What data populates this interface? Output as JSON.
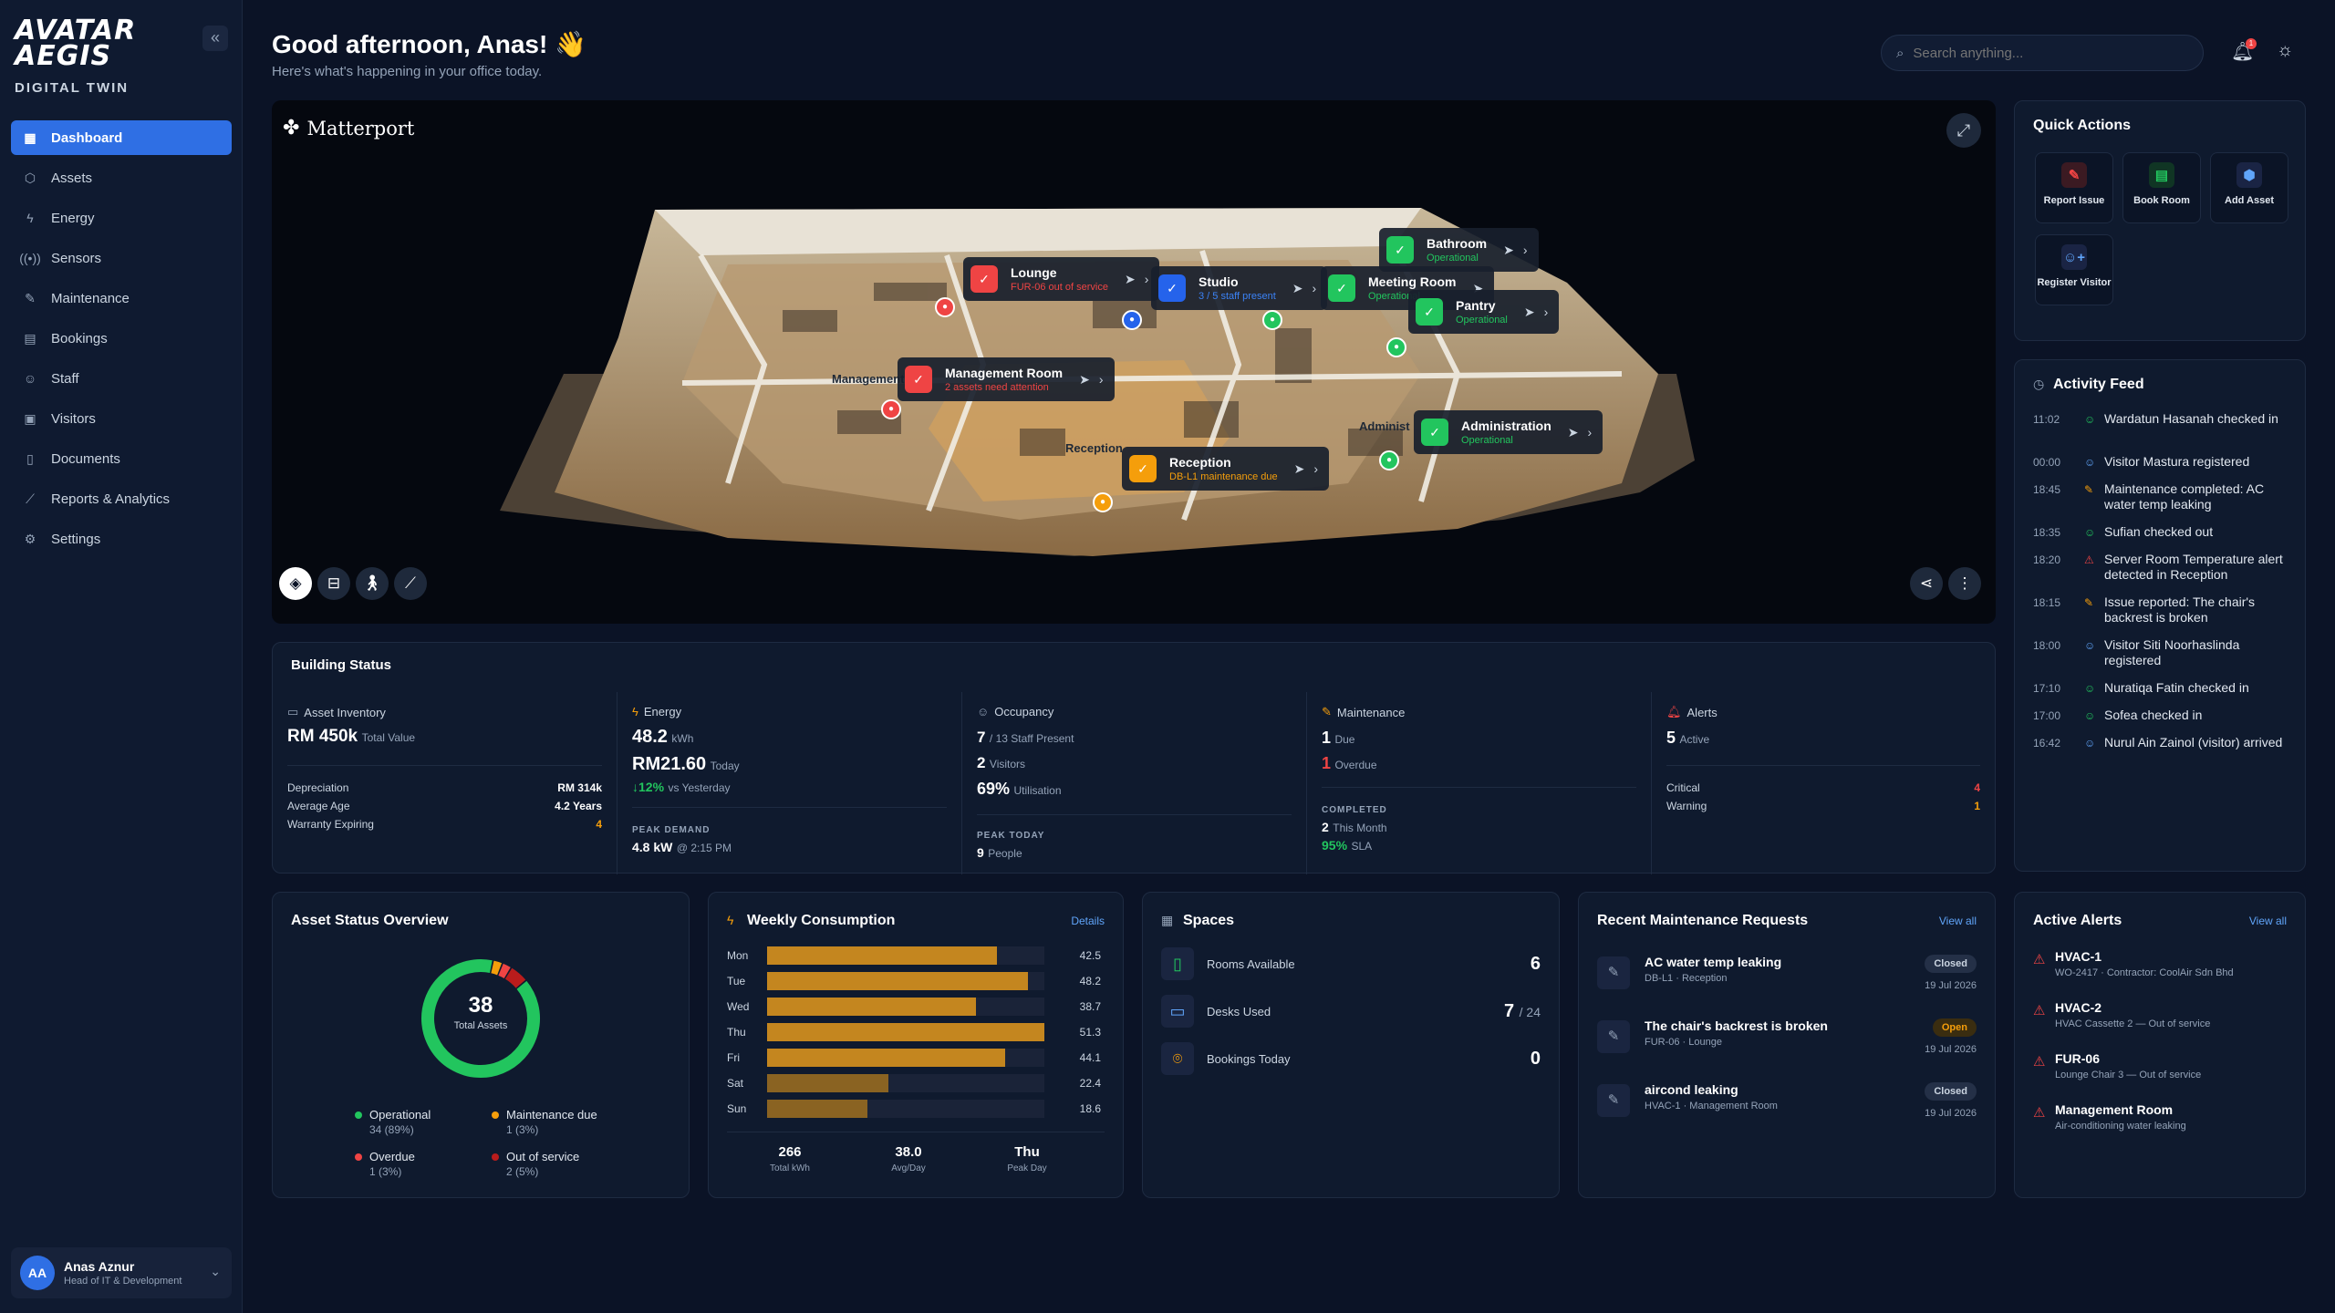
{
  "brand": {
    "logo_line1": "AVATAR",
    "logo_line2": "AEGIS",
    "subtitle": "DIGITAL TWIN"
  },
  "sidebar": {
    "items": [
      {
        "label": "Dashboard",
        "icon": "grid-icon"
      },
      {
        "label": "Assets",
        "icon": "cubes-icon"
      },
      {
        "label": "Energy",
        "icon": "bolt-icon"
      },
      {
        "label": "Sensors",
        "icon": "signal-icon"
      },
      {
        "label": "Maintenance",
        "icon": "wrench-icon"
      },
      {
        "label": "Bookings",
        "icon": "calendar-icon"
      },
      {
        "label": "Staff",
        "icon": "user-icon"
      },
      {
        "label": "Visitors",
        "icon": "id-card-icon"
      },
      {
        "label": "Documents",
        "icon": "document-icon"
      },
      {
        "label": "Reports & Analytics",
        "icon": "chart-icon"
      },
      {
        "label": "Settings",
        "icon": "gear-icon"
      }
    ],
    "user": {
      "initials": "AA",
      "name": "Anas Aznur",
      "role": "Head of IT & Development"
    }
  },
  "header": {
    "greeting": "Good afternoon, Anas! 👋",
    "sub": "Here's what's happening in your office today.",
    "search_placeholder": "Search anything...",
    "notif_count": "1"
  },
  "viewer": {
    "brand": "Matterport",
    "rooms": [
      {
        "name": "Lounge",
        "status": "FUR-06 out of service",
        "state": "red"
      },
      {
        "name": "Studio",
        "status": "3 / 5 staff present",
        "state": "blue"
      },
      {
        "name": "Meeting Room",
        "status": "Operational",
        "state": "green"
      },
      {
        "name": "Bathroom",
        "status": "Operational",
        "state": "green"
      },
      {
        "name": "Pantry",
        "status": "Operational",
        "state": "green"
      },
      {
        "name": "Management Room",
        "status": "2 assets need attention",
        "state": "red"
      },
      {
        "name": "Administration",
        "status": "Operational",
        "state": "green"
      },
      {
        "name": "Reception",
        "status": "DB-L1 maintenance due",
        "state": "orange"
      }
    ],
    "floor_labels": [
      "Management",
      "Reception",
      "Administ"
    ]
  },
  "building_status": {
    "title": "Building Status",
    "asset": {
      "h": "Asset Inventory",
      "value": "RM 450k",
      "unit": "Total Value",
      "rows": [
        [
          "Depreciation",
          "RM 314k"
        ],
        [
          "Average Age",
          "4.2 Years"
        ],
        [
          "Warranty Expiring",
          "4"
        ]
      ]
    },
    "energy": {
      "h": "Energy",
      "kwh": "48.2",
      "kwh_u": "kWh",
      "cost": "RM21.60",
      "cost_u": "Today",
      "delta": "↓12%",
      "delta_u": "vs Yesterday",
      "peak_cap": "PEAK DEMAND",
      "peak": "4.8 kW",
      "peak_u": "@ 2:15 PM"
    },
    "occupancy": {
      "h": "Occupancy",
      "staff": "7",
      "staff_u": "/ 13 Staff Present",
      "visitors": "2",
      "visitors_u": "Visitors",
      "util": "69%",
      "util_u": "Utilisation",
      "peak_cap": "PEAK TODAY",
      "peak": "9",
      "peak_u": "People"
    },
    "maintenance": {
      "h": "Maintenance",
      "due": "1",
      "due_u": "Due",
      "overdue": "1",
      "overdue_u": "Overdue",
      "comp_cap": "COMPLETED",
      "comp": "2",
      "comp_u": "This Month",
      "sla": "95%",
      "sla_u": "SLA"
    },
    "alerts": {
      "h": "Alerts",
      "active": "5",
      "active_u": "Active",
      "rows": [
        [
          "Critical",
          "4"
        ],
        [
          "Warning",
          "1"
        ]
      ]
    }
  },
  "quick_actions": {
    "title": "Quick Actions",
    "items": [
      {
        "label": "Report Issue",
        "icon": "wrench-icon"
      },
      {
        "label": "Book Room",
        "icon": "calendar-icon"
      },
      {
        "label": "Add Asset",
        "icon": "box-icon"
      },
      {
        "label": "Register Visitor",
        "icon": "user-plus-icon"
      }
    ]
  },
  "activity": {
    "title": "Activity Feed",
    "items": [
      {
        "time": "11:02",
        "text": "Wardatun Hasanah checked in",
        "kind": "user"
      },
      {
        "time": "00:00",
        "text": "Visitor Mastura registered",
        "kind": "visitor"
      },
      {
        "time": "18:45",
        "text": "Maintenance completed: AC water temp leaking",
        "kind": "wrench"
      },
      {
        "time": "18:35",
        "text": "Sufian checked out",
        "kind": "user"
      },
      {
        "time": "18:20",
        "text": "Server Room Temperature alert detected in Reception",
        "kind": "alert"
      },
      {
        "time": "18:15",
        "text": "Issue reported: The chair's backrest is broken",
        "kind": "wrench"
      },
      {
        "time": "18:00",
        "text": "Visitor Siti Noorhaslinda registered",
        "kind": "visitor"
      },
      {
        "time": "17:10",
        "text": "Nuratiqa Fatin checked in",
        "kind": "user"
      },
      {
        "time": "17:00",
        "text": "Sofea checked in",
        "kind": "user"
      },
      {
        "time": "16:42",
        "text": "Nurul Ain Zainol (visitor) arrived",
        "kind": "visitor"
      }
    ]
  },
  "asset_overview": {
    "title": "Asset Status Overview",
    "total": "38",
    "total_label": "Total Assets",
    "segments": [
      {
        "name": "Operational",
        "count": 34,
        "label": "34 (89%)",
        "color": "#22c55e"
      },
      {
        "name": "Maintenance due",
        "count": 1,
        "label": "1 (3%)",
        "color": "#f59e0b"
      },
      {
        "name": "Overdue",
        "count": 1,
        "label": "1 (3%)",
        "color": "#ef4444"
      },
      {
        "name": "Out of service",
        "count": 2,
        "label": "2 (5%)",
        "color": "#b91c1c"
      }
    ]
  },
  "weekly": {
    "title": "Weekly Consumption",
    "link": "Details",
    "chart_data": {
      "type": "bar",
      "categories": [
        "Mon",
        "Tue",
        "Wed",
        "Thu",
        "Fri",
        "Sat",
        "Sun"
      ],
      "values": [
        42.5,
        48.2,
        38.7,
        51.3,
        44.1,
        22.4,
        18.6
      ],
      "xlim": [
        0,
        51.3
      ]
    },
    "summary": [
      {
        "v": "266",
        "l": "Total kWh"
      },
      {
        "v": "38.0",
        "l": "Avg/Day"
      },
      {
        "v": "Thu",
        "l": "Peak Day"
      }
    ]
  },
  "spaces": {
    "title": "Spaces",
    "rows": [
      {
        "label": "Rooms Available",
        "value": "6",
        "suffix": "",
        "icon": "door-icon"
      },
      {
        "label": "Desks Used",
        "value": "7",
        "suffix": "/ 24",
        "icon": "monitor-icon"
      },
      {
        "label": "Bookings Today",
        "value": "0",
        "suffix": "",
        "icon": "location-icon"
      }
    ]
  },
  "maint_requests": {
    "title": "Recent Maintenance Requests",
    "link": "View all",
    "items": [
      {
        "title": "AC water temp leaking",
        "sub": "DB-L1 · Reception",
        "status": "Closed",
        "date": "19 Jul 2026"
      },
      {
        "title": "The chair's backrest is broken",
        "sub": "FUR-06 · Lounge",
        "status": "Open",
        "date": "19 Jul 2026"
      },
      {
        "title": "aircond leaking",
        "sub": "HVAC-1 · Management Room",
        "status": "Closed",
        "date": "19 Jul 2026"
      }
    ]
  },
  "active_alerts": {
    "title": "Active Alerts",
    "link": "View all",
    "items": [
      {
        "title": "HVAC-1",
        "sub": "WO-2417 · Contractor: CoolAir Sdn Bhd"
      },
      {
        "title": "HVAC-2",
        "sub": "HVAC Cassette 2 — Out of service"
      },
      {
        "title": "FUR-06",
        "sub": "Lounge Chair 3 — Out of service"
      },
      {
        "title": "Management Room",
        "sub": "Air-conditioning water leaking"
      }
    ]
  }
}
